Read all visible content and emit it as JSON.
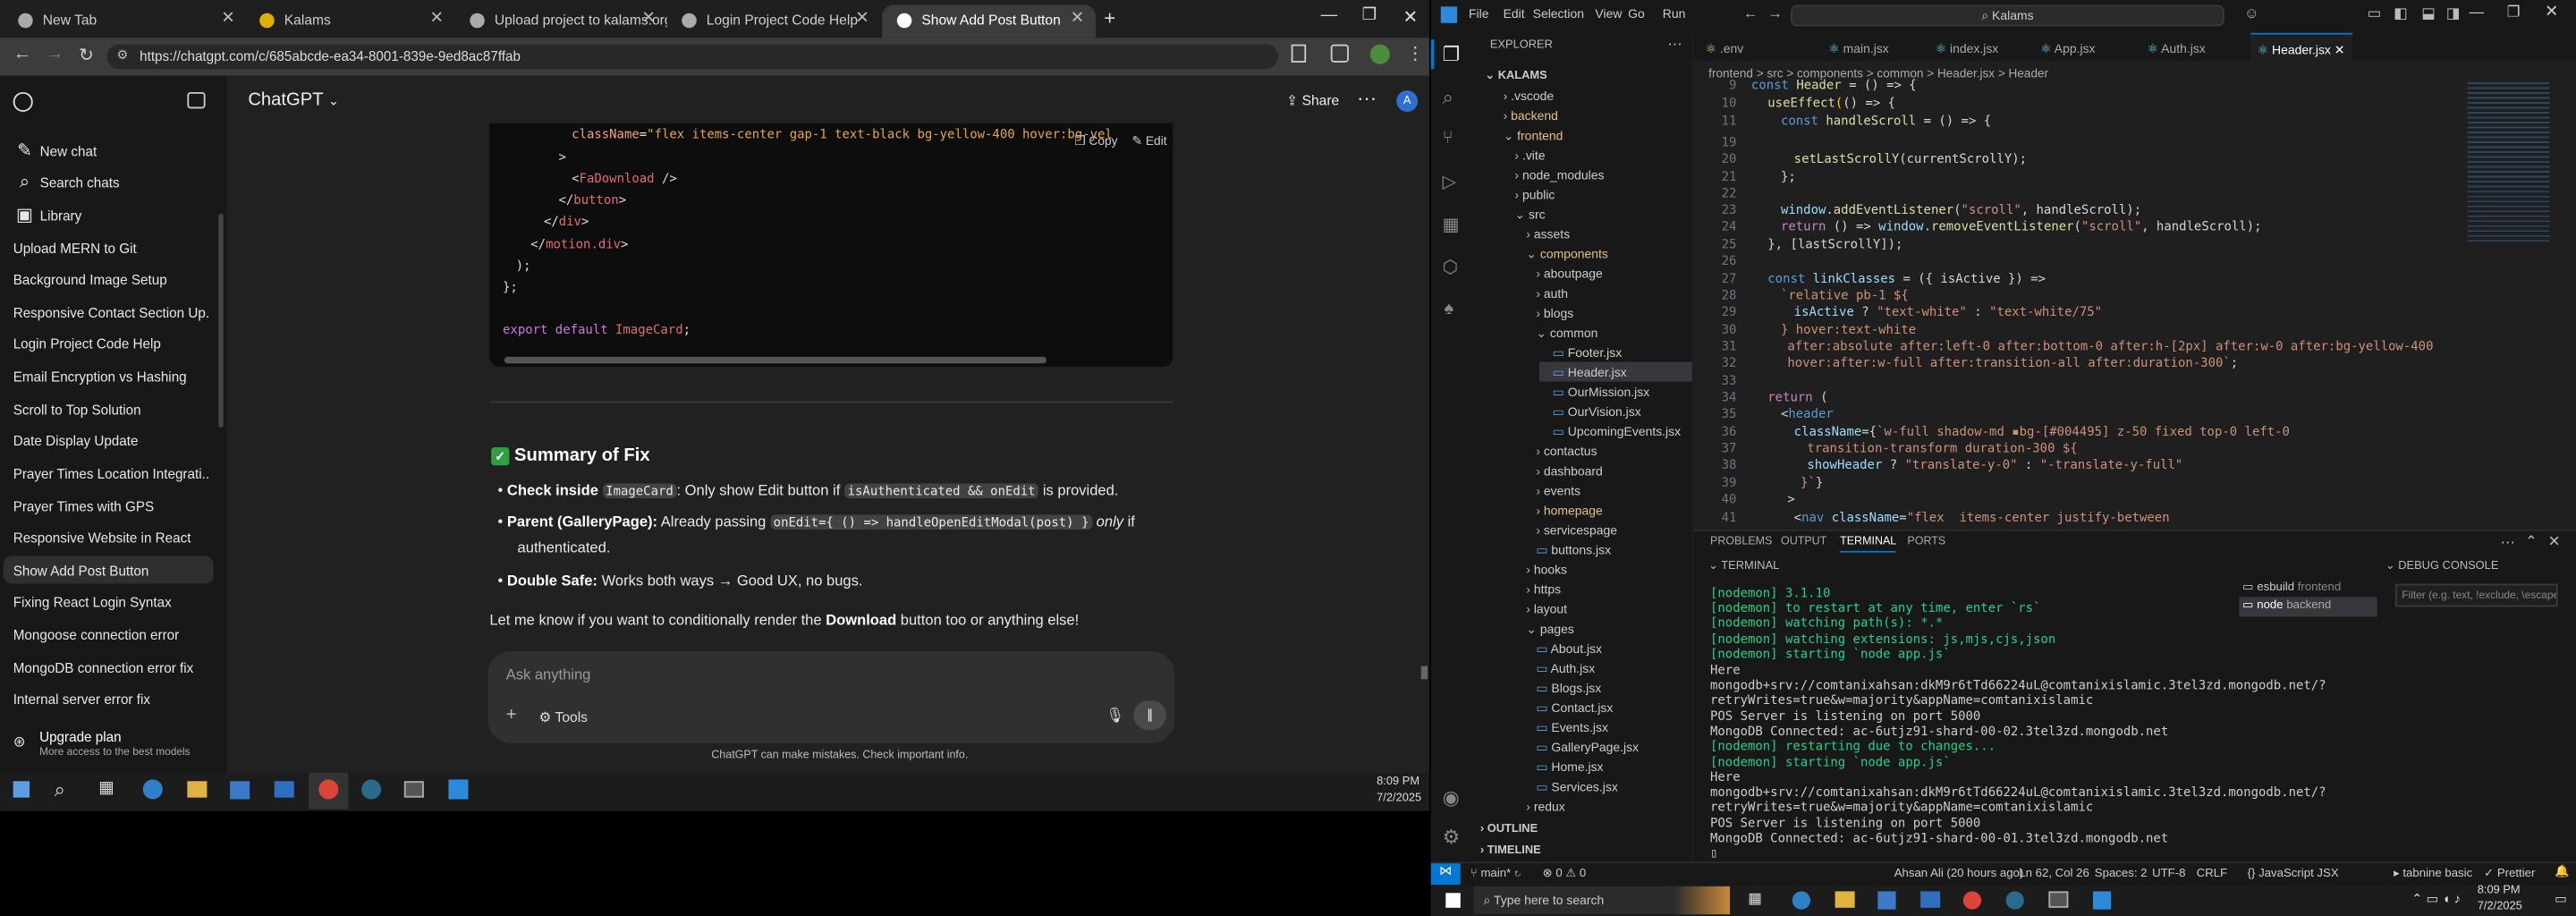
{
  "browser": {
    "tabs": [
      {
        "label": "New Tab"
      },
      {
        "label": "Kalams"
      },
      {
        "label": "Upload project to kalams.org"
      },
      {
        "label": "Login Project Code Help"
      },
      {
        "label": "Show Add Post Button"
      }
    ],
    "url": "https://chatgpt.com/c/685abcde-ea34-8001-839e-9ed8ac87ffab"
  },
  "chatgpt": {
    "app_title": "ChatGPT",
    "share_label": "Share",
    "nav": {
      "new_chat": "New chat",
      "search": "Search chats",
      "library": "Library"
    },
    "history": [
      "Upload MERN to Git",
      "Background Image Setup",
      "Responsive Contact Section Up...",
      "Login Project Code Help",
      "Email Encryption vs Hashing",
      "Scroll to Top Solution",
      "Date Display Update",
      "Prayer Times Location Integrati...",
      "Prayer Times with GPS",
      "Responsive Website in React",
      "Show Add Post Button",
      "Fixing React Login Syntax",
      "Mongoose connection error",
      "MongoDB connection error fix",
      "Internal server error fix"
    ],
    "upgrade": {
      "title": "Upgrade plan",
      "subtitle": "More access to the best models"
    },
    "code_copy": "Copy",
    "code_edit": "Edit",
    "summary_heading": "Summary of Fix",
    "b1_bold": "Check inside",
    "b1_code1": "ImageCard",
    "b1_text": ": Only show Edit button if",
    "b1_code2": "isAuthenticated && onEdit",
    "b1_end": "is provided.",
    "b2_bold": "Parent (GalleryPage):",
    "b2_text": "Already passing",
    "b2_code": "onEdit={ () => handleOpenEditModal(post) }",
    "b2_italic": "only",
    "b2_end": "if",
    "b2_line2": "authenticated.",
    "b3_bold": "Double Safe:",
    "b3_text": "Works both ways → Good UX, no bugs.",
    "closing": "Let me know if you want to conditionally render the",
    "closing_bold": "Download",
    "closing_end": "button too or anything else!",
    "placeholder": "Ask anything",
    "tools": "Tools",
    "disclaimer": "ChatGPT can make mistakes. Check important info."
  },
  "taskbar": {
    "time": "8:09 PM",
    "date": "7/2/2025",
    "search_placeholder": "Type here to search"
  },
  "vscode": {
    "menu": [
      "File",
      "Edit",
      "Selection",
      "View",
      "Go",
      "Run"
    ],
    "search": "Kalams",
    "explorer_title": "EXPLORER",
    "root": "KALAMS",
    "tabs": [
      ".env",
      "main.jsx",
      "index.jsx",
      "App.jsx",
      "Auth.jsx",
      "Header.jsx"
    ],
    "breadcrumb": "frontend > src > components > common > Header.jsx > Header",
    "panel_tabs": [
      "PROBLEMS",
      "OUTPUT",
      "TERMINAL",
      "PORTS"
    ],
    "terminal_label": "TERMINAL",
    "debug_label": "DEBUG CONSOLE",
    "debug_filter": "Filter (e.g. text, !exclude, \\escape)",
    "term_entries": [
      {
        "name": "esbuild",
        "sub": "frontend"
      },
      {
        "name": "node",
        "sub": "backend"
      }
    ],
    "outline": "OUTLINE",
    "timeline": "TIMELINE",
    "status": {
      "branch": "main*",
      "errors": "0",
      "warnings": "0",
      "blame": "Ahsan Ali (20 hours ago)",
      "pos": "Ln 62, Col 26",
      "spaces": "Spaces: 2",
      "enc": "UTF-8",
      "eol": "CRLF",
      "lang": "JavaScript JSX",
      "tabnine": "tabnine basic",
      "prettier": "Prettier"
    }
  }
}
